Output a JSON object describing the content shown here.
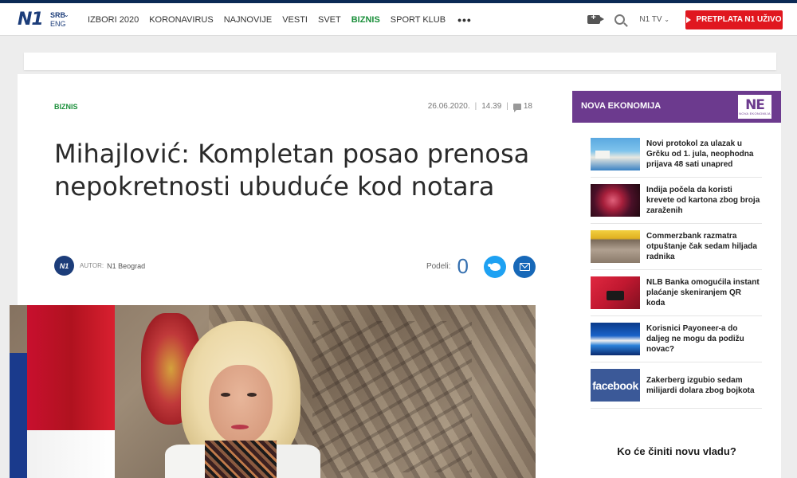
{
  "header": {
    "logo": "N1",
    "lang_selected": "SRB",
    "lang_other": "ENG",
    "nav": [
      {
        "label": "IZBORI 2020",
        "active": false
      },
      {
        "label": "KORONAVIRUS",
        "active": false
      },
      {
        "label": "NAJNOVIJE",
        "active": false
      },
      {
        "label": "VESTI",
        "active": false
      },
      {
        "label": "SVET",
        "active": false
      },
      {
        "label": "BIZNIS",
        "active": true
      },
      {
        "label": "SPORT KLUB",
        "active": false
      }
    ],
    "more": "•••",
    "tv_label": "N1 TV",
    "subscribe": "PRETPLATA N1 UŽIVO"
  },
  "article": {
    "category": "BIZNIS",
    "date": "26.06.2020.",
    "time": "14.39",
    "comments": "18",
    "title": "Mihajlović: Kompletan posao prenosa nepokretnosti ubuduće kod notara",
    "author_avatar": "N1",
    "author_label": "AUTOR:",
    "author_name": "N1 Beograd",
    "share_label": "Podeli:",
    "share_count": "0"
  },
  "sidebar": {
    "section_title": "NOVA EKONOMIJA",
    "logo_big": "NE",
    "logo_small": "NOVA EKONOMIJA",
    "items": [
      {
        "text": "Novi protokol za ulazak u Grčku od 1. jula, neophodna prijava 48 sati unapred"
      },
      {
        "text": "Indija počela da koristi krevete od kartona zbog broja zaraženih"
      },
      {
        "text": "Commerzbank razmatra otpuštanje čak sedam hiljada radnika"
      },
      {
        "text": "NLB Banka omogućila instant plaćanje skeniranjem QR koda"
      },
      {
        "text": "Korisnici Payoneer-a do daljeg ne mogu da podižu novac?"
      },
      {
        "text": "Zakerberg izgubio sedam milijardi dolara zbog bojkota",
        "thumb_text": "facebook"
      }
    ],
    "poll_title": "Ko će činiti novu vladu?"
  },
  "colors": {
    "brand_navy": "#1c3d7a",
    "accent_green": "#1a8f3a",
    "subscribe_red": "#e0171f",
    "sidebar_purple": "#6c3a8e"
  }
}
